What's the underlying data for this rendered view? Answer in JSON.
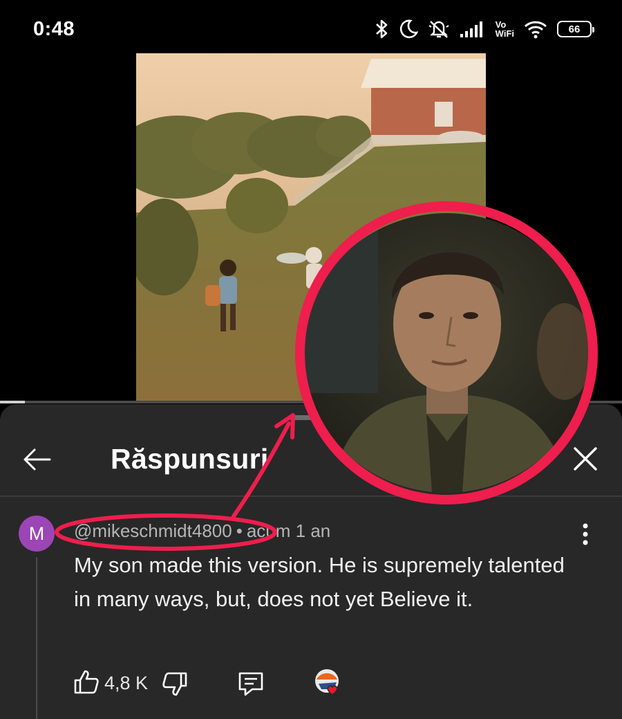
{
  "status_bar": {
    "time": "0:48",
    "vowifi_top": "Vo",
    "vowifi_bottom": "WiFi",
    "battery": "66"
  },
  "video": {
    "progress": 0.04
  },
  "sheet": {
    "title": "Răspunsuri"
  },
  "comment": {
    "avatar_letter": "M",
    "avatar_color": "#9c45b5",
    "author": "@mikeschmidt4800",
    "separator": "•",
    "time": "acum 1 an",
    "text": "My son made this version.  He is supremely talented in many ways, but, does not yet Believe it.",
    "like_count": "4,8 K"
  },
  "annotation": {
    "color": "#ee1e4d"
  }
}
